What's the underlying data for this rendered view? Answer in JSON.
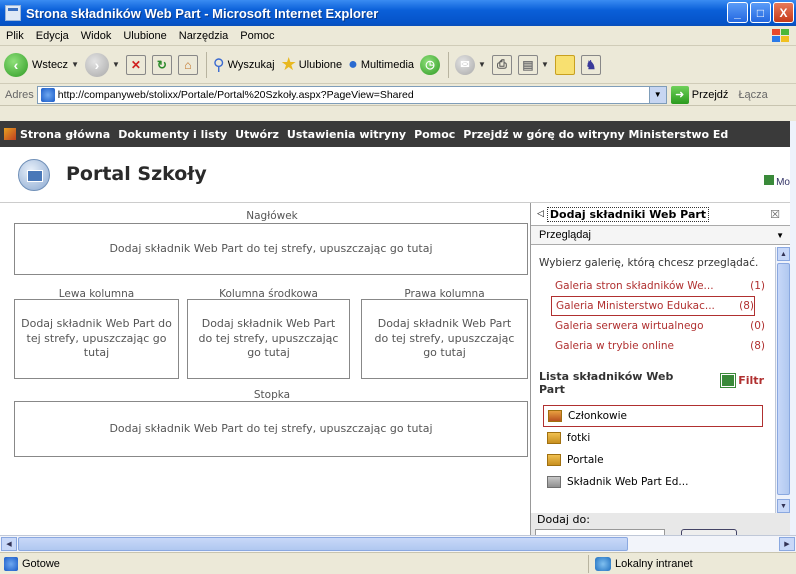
{
  "window": {
    "title": "Strona składników Web Part - Microsoft Internet Explorer",
    "buttons": [
      "_",
      "□",
      "X"
    ]
  },
  "menu": [
    "Plik",
    "Edycja",
    "Widok",
    "Ulubione",
    "Narzędzia",
    "Pomoc"
  ],
  "toolbar": {
    "back": "Wstecz",
    "search": "Wyszukaj",
    "favorites": "Ulubione",
    "media": "Multimedia"
  },
  "address": {
    "label": "Adres",
    "url": "http://companyweb/stolixx/Portale/Portal%20Szkoły.aspx?PageView=Shared",
    "go": "Przejdź",
    "links": "Łącza"
  },
  "sp_nav": {
    "items": [
      "Strona główna",
      "Dokumenty i listy",
      "Utwórz",
      "Ustawienia witryny",
      "Pomoc",
      "Przejdź w górę do witryny Ministerstwo Ed"
    ]
  },
  "site": {
    "title": "Portal Szkoły",
    "modify": "Mo"
  },
  "zones": {
    "header_label": "Nagłówek",
    "left_label": "Lewa kolumna",
    "middle_label": "Kolumna środkowa",
    "right_label": "Prawa kolumna",
    "footer_label": "Stopka",
    "drop_text_wide": "Dodaj składnik Web Part do tej strefy, upuszczając go tutaj",
    "drop_left": "Dodaj składnik Web Part do tej strefy, upuszczając go tutaj",
    "drop_middle": "Dodaj składnik Web Part do tej strefy, upuszczając go tutaj",
    "drop_right": "Dodaj składnik Web Part do tej strefy, upuszczając go tutaj",
    "drop_footer": "Dodaj składnik Web Part do tej strefy, upuszczając go tutaj"
  },
  "pane": {
    "title": "Dodaj składniki Web Part",
    "close": "☒",
    "mode": "Przeglądaj",
    "description": "Wybierz galerię, którą chcesz przeglądać.",
    "galleries": [
      {
        "name": "Galeria stron składników We...",
        "count": "(1)"
      },
      {
        "name": "Galeria Ministerstwo Edukac...",
        "count": "(8)"
      },
      {
        "name": "Galeria serwera wirtualnego",
        "count": "(0)"
      },
      {
        "name": "Galeria w trybie online",
        "count": "(8)"
      }
    ],
    "list_title": "Lista składników Web Part",
    "filter": "Filtr",
    "parts": [
      "Członkowie",
      "fotki",
      "Portale",
      "Składnik Web Part Ed..."
    ],
    "add_to": "Dodaj do:"
  },
  "status": {
    "text": "Gotowe",
    "zone": "Lokalny intranet"
  }
}
